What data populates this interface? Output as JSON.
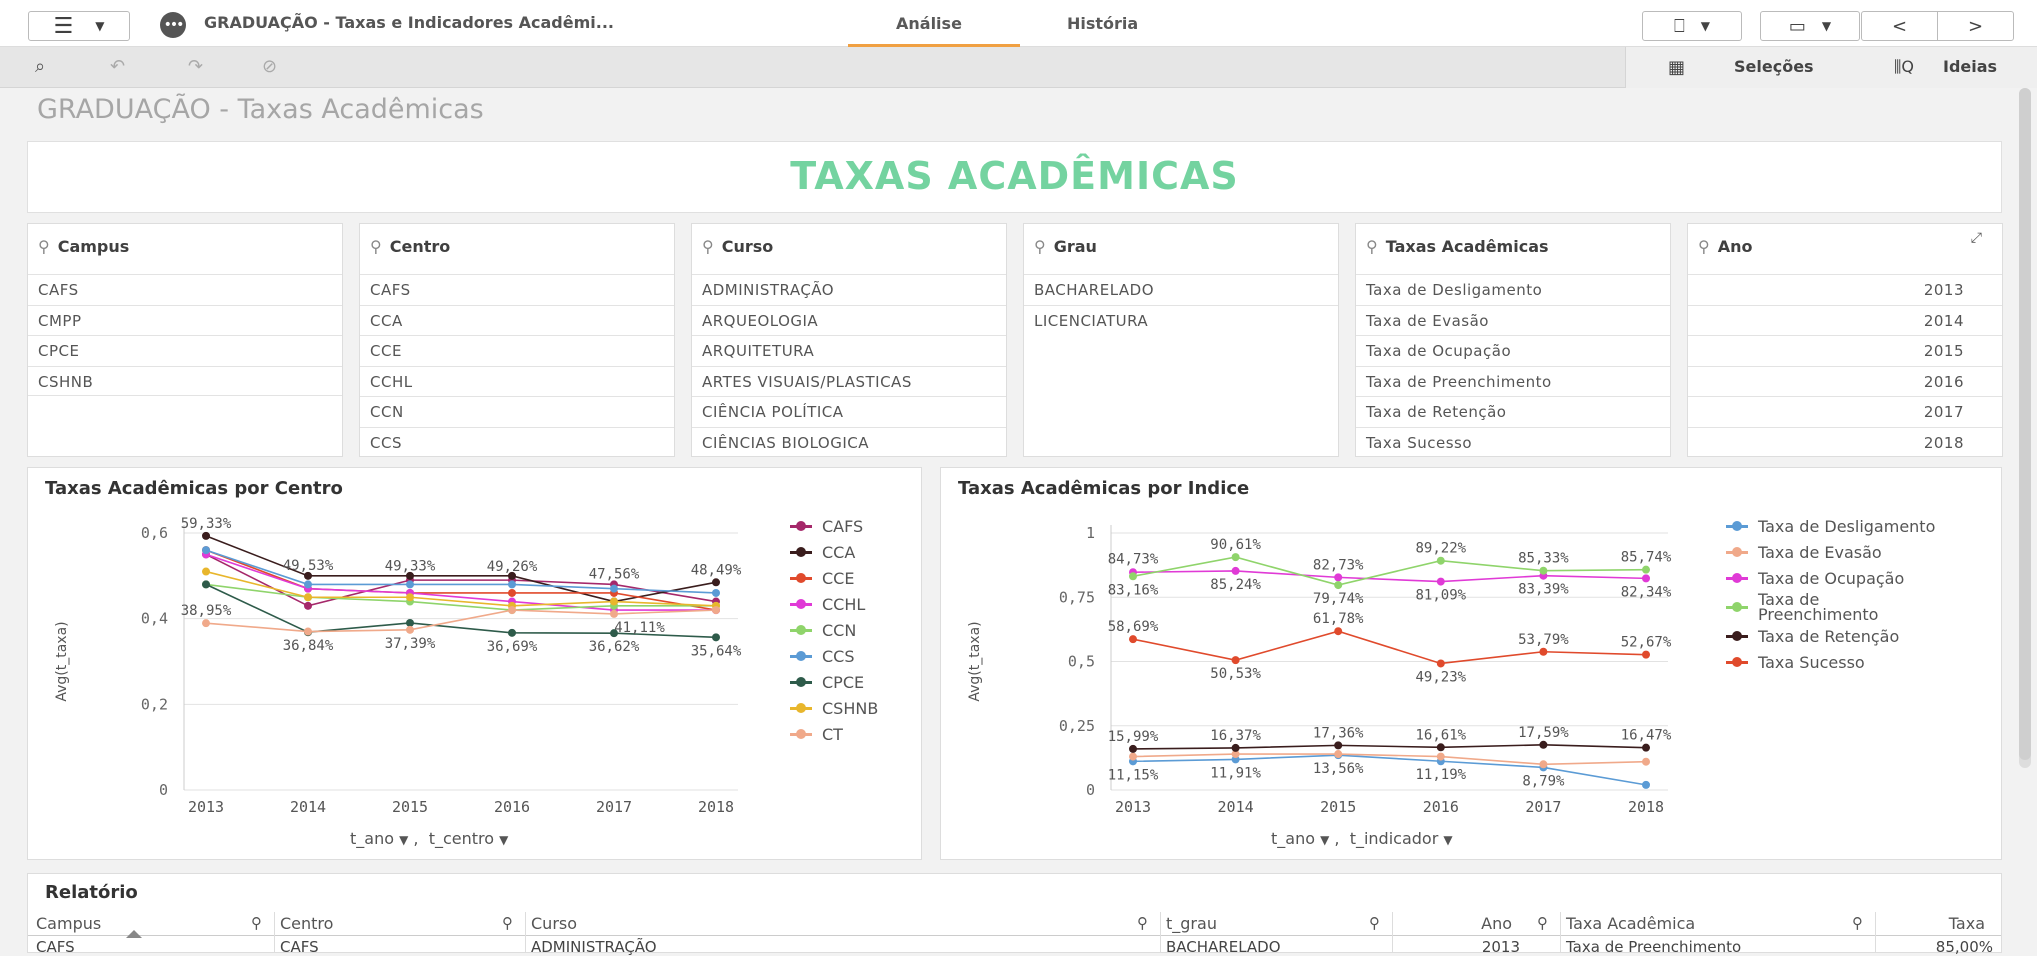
{
  "topbar": {
    "menu_icon": "☰",
    "app_icon": "•••",
    "app_title": "GRADUAÇÃO - Taxas e Indicadores Acadêmi...",
    "tabs": [
      "Análise",
      "História"
    ],
    "bookmark_icon": "🔖",
    "device_icon": "▭",
    "prev_icon": "<",
    "next_icon": ">"
  },
  "toolbar": {
    "icons": [
      "search-lasso-icon",
      "back-icon",
      "forward-icon",
      "clear-icon"
    ],
    "selections_label": "Seleções",
    "ideas_label": "Ideias"
  },
  "sheet": {
    "title": "GRADUAÇÃO - Taxas Acadêmicas"
  },
  "banner": {
    "text": "TAXAS ACADÊMICAS"
  },
  "filters": [
    {
      "title": "Campus",
      "items": [
        "CAFS",
        "CMPP",
        "CPCE",
        "CSHNB"
      ]
    },
    {
      "title": "Centro",
      "items": [
        "CAFS",
        "CCA",
        "CCE",
        "CCHL",
        "CCN",
        "CCS"
      ]
    },
    {
      "title": "Curso",
      "items": [
        "ADMINISTRAÇÃO",
        "ARQUEOLOGIA",
        "ARQUITETURA",
        "ARTES VISUAIS/PLASTICAS",
        "CIÊNCIA POLÍTICA",
        "CIÊNCIAS BIOLOGICA"
      ]
    },
    {
      "title": "Grau",
      "items": [
        "BACHARELADO",
        "LICENCIATURA"
      ]
    },
    {
      "title": "Taxas Acadêmicas",
      "items": [
        "Taxa de Desligamento",
        "Taxa de Evasão",
        "Taxa de Ocupação",
        "Taxa de Preenchimento",
        "Taxa de Retenção",
        "Taxa Sucesso"
      ]
    },
    {
      "title": "Ano",
      "items": [
        "2013",
        "2014",
        "2015",
        "2016",
        "2017",
        "2018"
      ]
    }
  ],
  "chart_data": [
    {
      "type": "line",
      "title": "Taxas Acadêmicas por Centro",
      "ylabel": "Avg(t_taxa)",
      "xdims": [
        "t_ano",
        "t_centro"
      ],
      "x": [
        "2013",
        "2014",
        "2015",
        "2016",
        "2017",
        "2018"
      ],
      "ylim": [
        0,
        0.6
      ],
      "yticks": [
        "0",
        "0,2",
        "0,4",
        "0,6"
      ],
      "grid": true,
      "legend": "right",
      "series": [
        {
          "name": "CAFS",
          "color": "#a5286a",
          "values": [
            0.55,
            0.43,
            0.49,
            0.49,
            0.48,
            0.44
          ]
        },
        {
          "name": "CCA",
          "color": "#3a1d1d",
          "values": [
            0.5933,
            0.5,
            0.5,
            0.5,
            0.44,
            0.4849
          ]
        },
        {
          "name": "CCE",
          "color": "#e04a2c",
          "values": [
            0.56,
            0.47,
            0.46,
            0.46,
            0.46,
            0.42
          ]
        },
        {
          "name": "CCHL",
          "color": "#e03ad6",
          "values": [
            0.55,
            0.47,
            0.46,
            0.44,
            0.42,
            0.42
          ]
        },
        {
          "name": "CCN",
          "color": "#8fd46b",
          "values": [
            0.48,
            0.45,
            0.44,
            0.42,
            0.43,
            0.43
          ]
        },
        {
          "name": "CCS",
          "color": "#5b9bd5",
          "values": [
            0.56,
            0.48,
            0.48,
            0.48,
            0.47,
            0.46
          ]
        },
        {
          "name": "CPCE",
          "color": "#2e5b4a",
          "values": [
            0.48,
            0.3684,
            0.39,
            0.3669,
            0.3662,
            0.3564
          ]
        },
        {
          "name": "CSHNB",
          "color": "#e8b62c",
          "values": [
            0.51,
            0.45,
            0.45,
            0.43,
            0.44,
            0.43
          ]
        },
        {
          "name": "CT",
          "color": "#f0a98a",
          "values": [
            0.3895,
            0.37,
            0.3739,
            0.42,
            0.4111,
            0.42
          ]
        }
      ],
      "labels": [
        {
          "text": "59,33%",
          "xi": 0,
          "val": 0.5933,
          "pos": "above"
        },
        {
          "text": "38,95%",
          "xi": 0,
          "val": 0.3895,
          "pos": "above"
        },
        {
          "text": "49,53%",
          "xi": 1,
          "val": 0.495,
          "pos": "above"
        },
        {
          "text": "36,84%",
          "xi": 1,
          "val": 0.3684,
          "pos": "below"
        },
        {
          "text": "49,33%",
          "xi": 2,
          "val": 0.4933,
          "pos": "above"
        },
        {
          "text": "37,39%",
          "xi": 2,
          "val": 0.3739,
          "pos": "below"
        },
        {
          "text": "49,26%",
          "xi": 3,
          "val": 0.4926,
          "pos": "above"
        },
        {
          "text": "36,69%",
          "xi": 3,
          "val": 0.3669,
          "pos": "below"
        },
        {
          "text": "47,56%",
          "xi": 4,
          "val": 0.4756,
          "pos": "above"
        },
        {
          "text": "36,62%",
          "xi": 4,
          "val": 0.3662,
          "pos": "below"
        },
        {
          "text": "41,11%",
          "xi": 4.25,
          "val": 0.4111,
          "pos": "below"
        },
        {
          "text": "48,49%",
          "xi": 5,
          "val": 0.4849,
          "pos": "above"
        },
        {
          "text": "35,64%",
          "xi": 5,
          "val": 0.3564,
          "pos": "below"
        }
      ]
    },
    {
      "type": "line",
      "title": "Taxas Acadêmicas por Indice",
      "ylabel": "Avg(t_taxa)",
      "xdims": [
        "t_ano",
        "t_indicador"
      ],
      "x": [
        "2013",
        "2014",
        "2015",
        "2016",
        "2017",
        "2018"
      ],
      "ylim": [
        0,
        1
      ],
      "yticks": [
        "0",
        "0,25",
        "0,5",
        "0,75",
        "1"
      ],
      "grid": true,
      "legend": "right",
      "series": [
        {
          "name": "Taxa de Desligamento",
          "color": "#5b9bd5",
          "values": [
            0.1115,
            0.1191,
            0.1356,
            0.1119,
            0.0879,
            0.02
          ]
        },
        {
          "name": "Taxa de Evasão",
          "color": "#f0a98a",
          "values": [
            0.13,
            0.14,
            0.14,
            0.13,
            0.1,
            0.11
          ]
        },
        {
          "name": "Taxa de Ocupação",
          "color": "#e03ad6",
          "values": [
            0.8473,
            0.8524,
            0.8273,
            0.8109,
            0.8339,
            0.8234
          ]
        },
        {
          "name": "Taxa de Preenchimento",
          "color": "#8fd46b",
          "values": [
            0.8316,
            0.9061,
            0.7974,
            0.8922,
            0.8533,
            0.8574
          ]
        },
        {
          "name": "Taxa de Retenção",
          "color": "#3a1d1d",
          "values": [
            0.1599,
            0.1637,
            0.1736,
            0.1661,
            0.1759,
            0.1647
          ]
        },
        {
          "name": "Taxa Sucesso",
          "color": "#e04a2c",
          "values": [
            0.5869,
            0.5053,
            0.6178,
            0.4923,
            0.5379,
            0.5267
          ]
        }
      ],
      "labels": [
        {
          "text": "84,73%",
          "xi": 0,
          "val": 0.85,
          "pos": "above"
        },
        {
          "text": "83,16%",
          "xi": 0,
          "val": 0.83,
          "pos": "below"
        },
        {
          "text": "90,61%",
          "xi": 1,
          "val": 0.9061,
          "pos": "above"
        },
        {
          "text": "85,24%",
          "xi": 1,
          "val": 0.8524,
          "pos": "below"
        },
        {
          "text": "82,73%",
          "xi": 2,
          "val": 0.8273,
          "pos": "above"
        },
        {
          "text": "79,74%",
          "xi": 2,
          "val": 0.7974,
          "pos": "below"
        },
        {
          "text": "89,22%",
          "xi": 3,
          "val": 0.8922,
          "pos": "above"
        },
        {
          "text": "81,09%",
          "xi": 3,
          "val": 0.8109,
          "pos": "below"
        },
        {
          "text": "85,33%",
          "xi": 4,
          "val": 0.8533,
          "pos": "above"
        },
        {
          "text": "83,39%",
          "xi": 4,
          "val": 0.8339,
          "pos": "below"
        },
        {
          "text": "85,74%",
          "xi": 5,
          "val": 0.8574,
          "pos": "above"
        },
        {
          "text": "82,34%",
          "xi": 5,
          "val": 0.8234,
          "pos": "below"
        },
        {
          "text": "58,69%",
          "xi": 0,
          "val": 0.5869,
          "pos": "above"
        },
        {
          "text": "50,53%",
          "xi": 1,
          "val": 0.5053,
          "pos": "below"
        },
        {
          "text": "61,78%",
          "xi": 2,
          "val": 0.6178,
          "pos": "above"
        },
        {
          "text": "49,23%",
          "xi": 3,
          "val": 0.4923,
          "pos": "below"
        },
        {
          "text": "53,79%",
          "xi": 4,
          "val": 0.5379,
          "pos": "above"
        },
        {
          "text": "52,67%",
          "xi": 5,
          "val": 0.5267,
          "pos": "above"
        },
        {
          "text": "15,99%",
          "xi": 0,
          "val": 0.1599,
          "pos": "above"
        },
        {
          "text": "11,15%",
          "xi": 0,
          "val": 0.1115,
          "pos": "below"
        },
        {
          "text": "16,37%",
          "xi": 1,
          "val": 0.1637,
          "pos": "above"
        },
        {
          "text": "11,91%",
          "xi": 1,
          "val": 0.1191,
          "pos": "below"
        },
        {
          "text": "17,36%",
          "xi": 2,
          "val": 0.1736,
          "pos": "above"
        },
        {
          "text": "13,56%",
          "xi": 2,
          "val": 0.1356,
          "pos": "below"
        },
        {
          "text": "16,61%",
          "xi": 3,
          "val": 0.1661,
          "pos": "above"
        },
        {
          "text": "11,19%",
          "xi": 3,
          "val": 0.1119,
          "pos": "below"
        },
        {
          "text": "17,59%",
          "xi": 4,
          "val": 0.1759,
          "pos": "above"
        },
        {
          "text": "8,79%",
          "xi": 4,
          "val": 0.0879,
          "pos": "below"
        },
        {
          "text": "16,47%",
          "xi": 5,
          "val": 0.1647,
          "pos": "above"
        }
      ]
    }
  ],
  "report": {
    "title": "Relatório",
    "columns": [
      "Campus",
      "Centro",
      "Curso",
      "t_grau",
      "Ano",
      "Taxa Acadêmica",
      "Taxa"
    ],
    "first_row": [
      "CAFS",
      "CAFS",
      "ADMINISTRAÇÃO",
      "BACHARELADO",
      "2013",
      "Taxa de Preenchimento",
      "85,00%"
    ]
  }
}
